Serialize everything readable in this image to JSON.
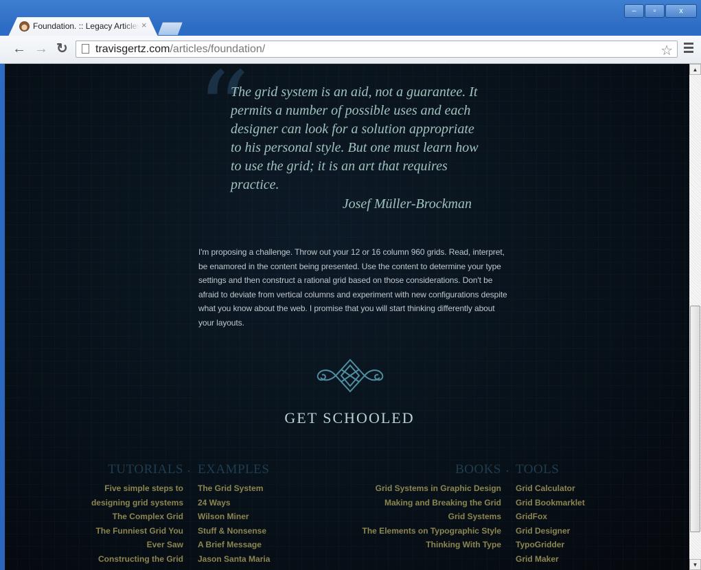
{
  "browser": {
    "tab_title": "Foundation. :: Legacy Articles",
    "tab_close": "×",
    "url_host": "travisgertz.com",
    "url_path": "/articles/foundation/",
    "window_buttons": {
      "minimize": "–",
      "maximize": "▫",
      "close": "x"
    }
  },
  "article": {
    "quote": "The grid system is an aid, not a guarantee. It permits a number of possible uses and each designer can look for a solution appropriate to his personal style. But one must learn how to use the grid; it is an art that requires practice.",
    "quote_author": "Josef Müller-Brockman",
    "intro": "I'm proposing a challenge. Throw out your 12 or 16 column 960 grids. Read, interpret, be enamored in the content being presented. Use the content to determine your type settings and then construct a rational grid based on those considerations. Don't be afraid to deviate from vertical columns and experiment with new configurations despite what you know about the web. I promise that you will start thinking differently about your layouts.",
    "section_heading": "GET SCHOOLED"
  },
  "resources": {
    "separator": "·",
    "tutorials": {
      "heading": "TUTORIALS",
      "items": [
        "Five simple steps to designing grid systems",
        "The Complex Grid",
        "The Funniest Grid You Ever Saw",
        "Constructing the Grid"
      ]
    },
    "examples": {
      "heading": "EXAMPLES",
      "items": [
        "The Grid System",
        "24 Ways",
        "Wilson Miner",
        "Stuff & Nonsense",
        "A Brief Message",
        "Jason Santa Maria"
      ]
    },
    "books": {
      "heading": "BOOKS",
      "items": [
        "Grid Systems in Graphic Design",
        "Making and Breaking the Grid",
        "Grid Systems",
        "The Elements on Typographic Style",
        "Thinking With Type"
      ]
    },
    "tools": {
      "heading": "TOOLS",
      "items": [
        "Grid Calculator",
        "Grid Bookmarklet",
        "GridFox",
        "Grid Designer",
        "TypoGridder",
        "Grid Maker"
      ]
    }
  },
  "colors": {
    "page_background": "#081119",
    "quote": "#9fc2bc",
    "body_text": "#bfc7cc",
    "link": "#8c8650",
    "column_heading": "#1f3d52"
  }
}
